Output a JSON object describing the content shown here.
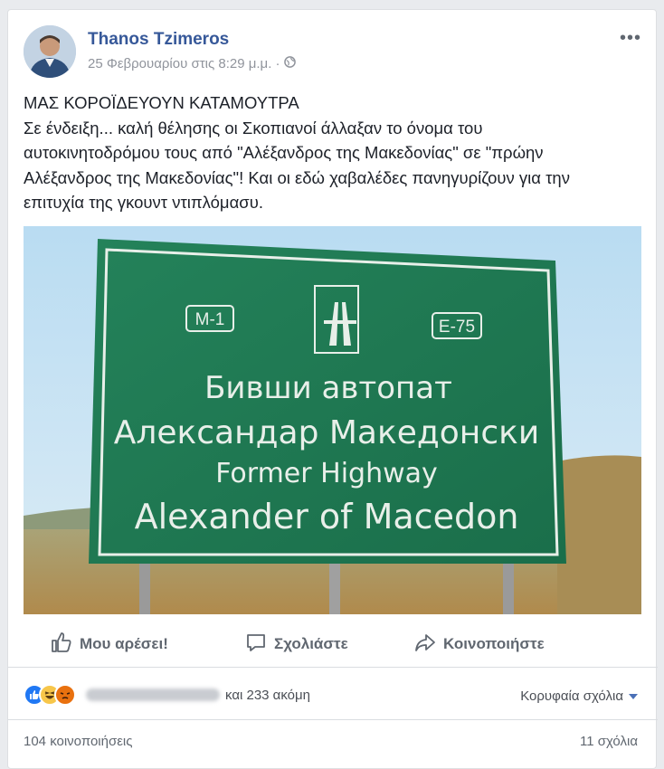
{
  "post": {
    "author": "Thanos Tzimeros",
    "date": "25 Φεβρουαρίου στις 8:29 μ.μ. ·",
    "privacy_icon": "globe-icon",
    "text_lines": [
      "ΜΑΣ ΚΟΡΟΪΔΕΥΟΥΝ ΚΑΤΑΜΟΥΤΡΑ",
      "Σε ένδειξη... καλή θέλησης οι Σκοπιανοί άλλαξαν το όνομα του",
      "αυτοκινητοδρόμου τους από \"Αλέξανδρος της Μακεδονίας\" σε \"πρώην",
      "Αλέξανδρος της Μακεδονίας\"! Και οι εδώ χαβαλέδες πανηγυρίζουν για την",
      "επιτυχία της γκουντ ντιπλόμασυ."
    ]
  },
  "sign": {
    "left_code": "M-1",
    "right_code": "E-75",
    "line1": "Бивши автопат",
    "line2": "Александар Македонски",
    "line3": "Former Highway",
    "line4": "Alexander of Macedon"
  },
  "actions": {
    "like": "Μου αρέσει!",
    "comment": "Σχολιάστε",
    "share": "Κοινοποιήστε"
  },
  "stats": {
    "others": "και 233 ακόμη",
    "top_comments": "Κορυφαία σχόλια",
    "shares": "104 κοινοποιήσεις",
    "comments": "11 σχόλια"
  },
  "colors": {
    "link": "#365899",
    "sign_green": "#1f7a52",
    "like_blue": "#2078f4"
  }
}
